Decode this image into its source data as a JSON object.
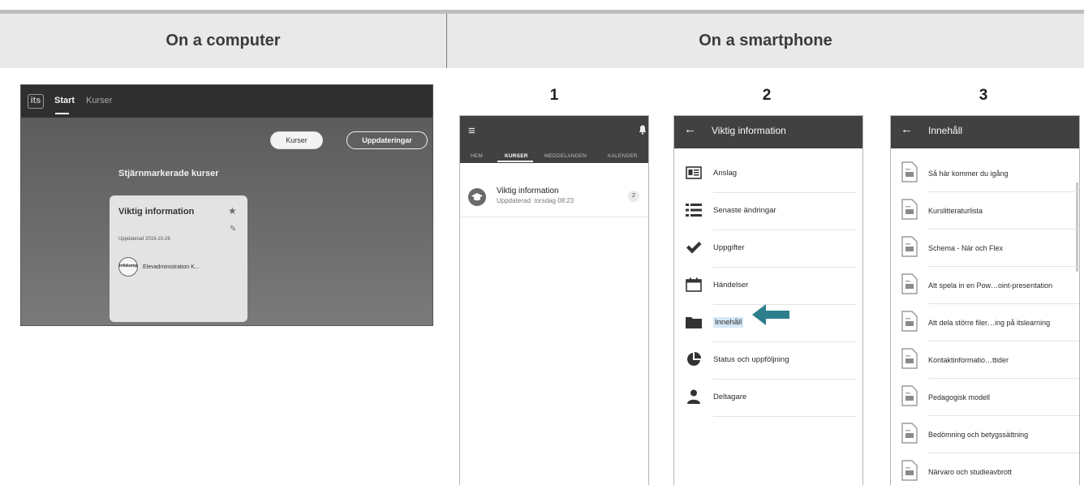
{
  "headers": {
    "computer": "On a computer",
    "smartphone": "On a smartphone"
  },
  "steps": [
    "1",
    "2",
    "3"
  ],
  "desktop": {
    "logo": "its",
    "nav": [
      "Start",
      "Kurser"
    ],
    "buttons": {
      "kurser": "Kurser",
      "updates": "Uppdateringar"
    },
    "section_title": "Stjärnmarkerade kurser",
    "card": {
      "title": "Viktig information",
      "date": "Uppdaterad 2019-10-28",
      "avatar": "infokomp",
      "owner": "Elevadministration K..."
    }
  },
  "phone1": {
    "tabs": [
      "HEM",
      "KURSER",
      "MEDDELANDEN",
      "KALENDER"
    ],
    "course": {
      "title": "Viktig information",
      "subtitle": "Uppdaterad: torsdag 08:23",
      "badge": "2"
    }
  },
  "phone2": {
    "title": "Viktig information",
    "items": [
      {
        "label": "Anslag",
        "icon": "bulletin-icon"
      },
      {
        "label": "Senaste ändringar",
        "icon": "list-icon"
      },
      {
        "label": "Uppgifter",
        "icon": "checkmark-icon"
      },
      {
        "label": "Händelser",
        "icon": "calendar-icon"
      },
      {
        "label": "Innehåll",
        "icon": "folder-icon"
      },
      {
        "label": "Status och uppföljning",
        "icon": "pie-chart-icon"
      },
      {
        "label": "Deltagare",
        "icon": "person-icon"
      }
    ],
    "highlight_color": "#d6e8f7",
    "arrow_color": "#2d7f8c"
  },
  "phone3": {
    "title": "Innehåll",
    "items": [
      "Så här kommer du igång",
      "Kurslitteraturlista",
      "Schema - När och Flex",
      "Att spela in en Pow…oint-presentation",
      "Att dela större filer…ing på itslearning",
      "Kontaktinformatio…ttider",
      "Pedagogisk modell",
      "Bedömning och betygssättning",
      "Närvaro och studieavbrott"
    ]
  }
}
